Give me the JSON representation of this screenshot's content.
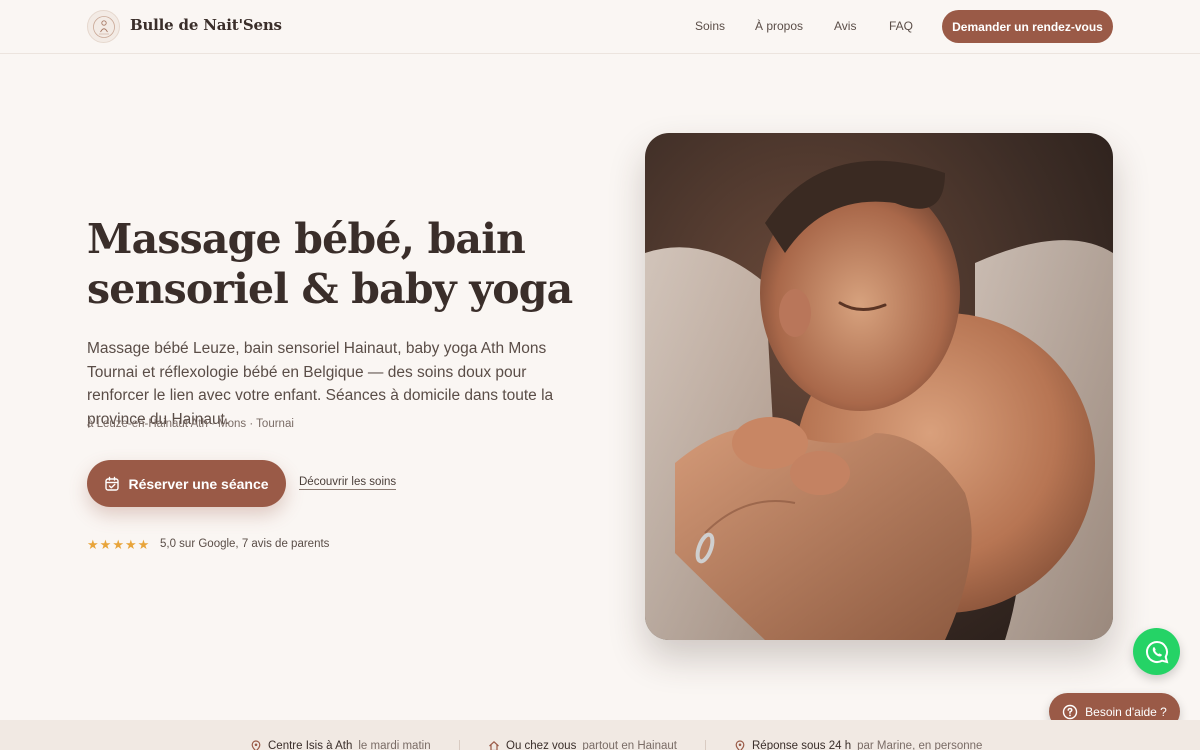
{
  "header": {
    "brand": "Bulle de Nait'Sens",
    "nav": [
      "Soins",
      "À propos",
      "Avis",
      "FAQ"
    ],
    "cta": "Demander un rendez-vous"
  },
  "hero": {
    "title": "Massage bébé, bain sensoriel & baby yoga",
    "description": "Massage bébé Leuze, bain sensoriel Hainaut, baby yoga Ath Mons Tournai et réflexologie bébé en Belgique — des soins doux pour renforcer le lien avec votre enfant. Séances à domicile dans toute la province du Hainaut.",
    "locations": "à Leuze-en-Hainaut Ath · Mons · Tournai",
    "book_button": "Réserver une séance",
    "discover_link": "Découvrir les soins",
    "rating_stars": 5,
    "rating_text": "5,0 sur Google, 7 avis de parents"
  },
  "floating": {
    "help_label": "Besoin d'aide ?"
  },
  "strip": [
    {
      "title": "Centre Isis à Ath",
      "sub": "le mardi matin"
    },
    {
      "title": "Ou chez vous",
      "sub": "partout en Hainaut"
    },
    {
      "title": "Réponse sous 24 h",
      "sub": "par Marine, en personne"
    }
  ],
  "colors": {
    "accent": "#9a5a47",
    "background": "#faf6f3",
    "whatsapp": "#25d366",
    "star": "#e8a43a"
  },
  "icons": {
    "book_button": "calendar-check-icon",
    "whatsapp": "whatsapp-icon",
    "help": "question-circle-icon",
    "strip": [
      "map-pin-icon",
      "home-icon",
      "map-pin-icon"
    ]
  }
}
